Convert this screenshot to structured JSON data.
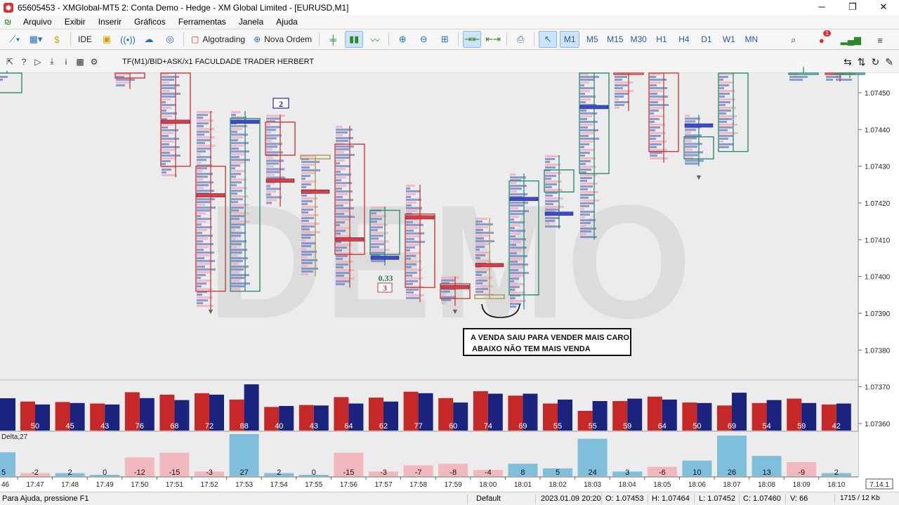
{
  "window": {
    "title": "65605453 - XMGlobal-MT5 2: Conta Demo - Hedge - XM Global Limited - [EURUSD,M1]",
    "minimize": "─",
    "maximize": "❐",
    "close": "✕"
  },
  "menu": [
    "Arquivo",
    "Exibir",
    "Inserir",
    "Gráficos",
    "Ferramentas",
    "Janela",
    "Ajuda"
  ],
  "toolbar": {
    "ide": "IDE",
    "algotrading": "Algotrading",
    "nova_ordem": "Nova Ordem",
    "timeframes": [
      "M1",
      "M5",
      "M15",
      "M30",
      "H1",
      "H4",
      "D1",
      "W1",
      "MN"
    ],
    "active_timeframe": "M1",
    "notifications": "1"
  },
  "chart_header": {
    "label": "TF(M1)/BID+ASK/x1  FACULDADE TRADER HERBERT"
  },
  "chart": {
    "watermark": "DEMO",
    "annotation_line1": "A VENDA SAIU PARA VENDER MAIS CARO",
    "annotation_line2": "ABAIXO NÃO TEM MAIS VENDA",
    "marker_2": "2",
    "marker_3": "3",
    "marker_ratio": "0.33",
    "price_levels": [
      "1.07450",
      "1.07440",
      "1.07430",
      "1.07420",
      "1.07410",
      "1.07400",
      "1.07390",
      "1.07380",
      "1.07370",
      "1.07360"
    ],
    "candles": [
      {
        "o": 1.0745,
        "h": 1.07456,
        "l": 1.07456,
        "c": 1.07456,
        "dir": "up"
      },
      {
        "o": 1.07457,
        "h": 1.07457,
        "l": 1.07451,
        "c": 1.07454,
        "dir": "down"
      },
      {
        "o": 1.07457,
        "h": 1.07457,
        "l": 1.07427,
        "c": 1.0743,
        "dir": "down"
      },
      {
        "o": 1.0743,
        "h": 1.07412,
        "l": 1.07396,
        "c": 1.07396,
        "dir": "down",
        "hi": 1.07445,
        "lo": 1.07391
      },
      {
        "o": 1.07396,
        "h": 1.07445,
        "l": 1.07396,
        "c": 1.07443,
        "dir": "up",
        "hi": 1.07445,
        "lo": 1.07396
      },
      {
        "o": 1.07442,
        "h": 1.07443,
        "l": 1.07433,
        "c": 1.07433,
        "dir": "down",
        "hi": 1.07444,
        "lo": 1.07419
      },
      {
        "o": 1.07433,
        "h": 1.07433,
        "l": 1.07432,
        "c": 1.07432,
        "dir": "doji",
        "hi": 1.07433,
        "lo": 1.074
      },
      {
        "o": 1.07436,
        "h": 1.07436,
        "l": 1.07406,
        "c": 1.07406,
        "dir": "down",
        "hi": 1.07441,
        "lo": 1.07397
      },
      {
        "o": 1.07406,
        "h": 1.07418,
        "l": 1.07406,
        "c": 1.07418,
        "dir": "up",
        "hi": 1.07419,
        "lo": 1.07403
      },
      {
        "o": 1.07417,
        "h": 1.07417,
        "l": 1.07397,
        "c": 1.07397,
        "dir": "down",
        "hi": 1.07425,
        "lo": 1.07393
      },
      {
        "o": 1.07398,
        "h": 1.07398,
        "l": 1.07394,
        "c": 1.07394,
        "dir": "down",
        "hi": 1.074,
        "lo": 1.07392
      },
      {
        "o": 1.07395,
        "h": 1.07395,
        "l": 1.07394,
        "c": 1.07394,
        "dir": "doji",
        "hi": 1.07416,
        "lo": 1.07394
      },
      {
        "o": 1.07395,
        "h": 1.07426,
        "l": 1.07395,
        "c": 1.07426,
        "dir": "up",
        "hi": 1.07428,
        "lo": 1.07391
      },
      {
        "o": 1.07423,
        "h": 1.07429,
        "l": 1.07423,
        "c": 1.07429,
        "dir": "up",
        "hi": 1.07433,
        "lo": 1.07413
      },
      {
        "o": 1.07428,
        "h": 1.07457,
        "l": 1.07428,
        "c": 1.07457,
        "dir": "up",
        "hi": 1.07457,
        "lo": 1.0741
      },
      {
        "o": 1.07457,
        "h": 1.07457,
        "l": 1.07457,
        "c": 1.07457,
        "dir": "down",
        "hi": 1.07457,
        "lo": 1.07445
      },
      {
        "o": 1.07457,
        "h": 1.07457,
        "l": 1.07434,
        "c": 1.07434,
        "dir": "down",
        "hi": 1.07457,
        "lo": 1.07431
      },
      {
        "o": 1.07432,
        "h": 1.07438,
        "l": 1.07432,
        "c": 1.07438,
        "dir": "up",
        "hi": 1.07444,
        "lo": 1.0743
      },
      {
        "o": 1.07434,
        "h": 1.07457,
        "l": 1.07434,
        "c": 1.07457,
        "dir": "up",
        "hi": 1.07457,
        "lo": 1.07434
      },
      {
        "o": 1.07457,
        "h": 1.07457,
        "l": 1.07457,
        "c": 1.07457,
        "dir": "up",
        "hi": 1.07457,
        "lo": 1.07457
      },
      {
        "o": 1.07456,
        "h": 1.07456,
        "l": 1.07455,
        "c": 1.07455,
        "dir": "down",
        "hi": 1.07457,
        "lo": 1.07453
      },
      {
        "o": 1.07456,
        "h": 1.07456,
        "l": 1.07456,
        "c": 1.07456,
        "dir": "up",
        "hi": 1.07457,
        "lo": 1.07454
      }
    ],
    "poc_levels": [
      null,
      null,
      1.07442,
      1.07422,
      1.07442,
      1.07426,
      1.07423,
      1.0741,
      1.07405,
      1.07416,
      1.07397,
      1.07403,
      1.07421,
      1.07417,
      1.07446,
      null,
      null,
      1.07441,
      null,
      null,
      null,
      null
    ]
  },
  "volume_panel": {
    "left_value": "9",
    "values": [
      "50",
      "45",
      "43",
      "76",
      "68",
      "72",
      "88",
      "40",
      "43",
      "64",
      "62",
      "77",
      "60",
      "74",
      "69",
      "55",
      "55",
      "59",
      "64",
      "50",
      "69",
      "54",
      "59",
      "42"
    ],
    "red": [
      59,
      58,
      55,
      78,
      73,
      76,
      63,
      48,
      52,
      68,
      67,
      79,
      66,
      80,
      71,
      55,
      40,
      60,
      69,
      57,
      51,
      56,
      65,
      53
    ],
    "blue": [
      53,
      56,
      53,
      66,
      62,
      73,
      94,
      50,
      51,
      55,
      59,
      76,
      57,
      75,
      75,
      63,
      60,
      65,
      63,
      56,
      77,
      62,
      56,
      55
    ]
  },
  "delta_panel": {
    "label": "Delta,27",
    "left_value": "5",
    "values": [
      "-2",
      "2",
      "0",
      "-12",
      "-15",
      "-3",
      "27",
      "2",
      "0",
      "-15",
      "-3",
      "-7",
      "-8",
      "-4",
      "8",
      "5",
      "24",
      "3",
      "-6",
      "10",
      "26",
      "13",
      "-9",
      "2"
    ],
    "num": [
      -2,
      2,
      0,
      -12,
      -15,
      -3,
      27,
      2,
      0,
      -15,
      -3,
      -7,
      -8,
      -4,
      8,
      5,
      24,
      3,
      -6,
      10,
      26,
      13,
      -9,
      2
    ]
  },
  "time_axis": {
    "left_cut": "46",
    "labels": [
      "17:47",
      "17:48",
      "17:49",
      "17:50",
      "17:51",
      "17:52",
      "17:53",
      "17:54",
      "17:55",
      "17:56",
      "17:57",
      "17:58",
      "17:59",
      "18:00",
      "18:01",
      "18:02",
      "18:03",
      "18:04",
      "18:05",
      "18:06",
      "18:07",
      "18:08",
      "18:09",
      "18:10"
    ],
    "version": "7.14.1"
  },
  "status": {
    "help": "Para Ajuda, pressione F1",
    "profile": "Default",
    "datetime": "2023.01.09 20:20",
    "open": "O: 1.07453",
    "high": "H: 1.07464",
    "low": "L: 1.07452",
    "close": "C: 1.07460",
    "volume": "V: 66",
    "traffic": "1715 / 12 Kb"
  },
  "colors": {
    "bull": "#2e8b7a",
    "bear": "#c83c3c",
    "vol_red": "#c62828",
    "vol_blue": "#1a237e",
    "delta_pos": "#7fbfdc",
    "delta_neg": "#f2b8c0",
    "profile_blue": "#6a7fc0",
    "profile_pink": "#f0a8b8"
  }
}
